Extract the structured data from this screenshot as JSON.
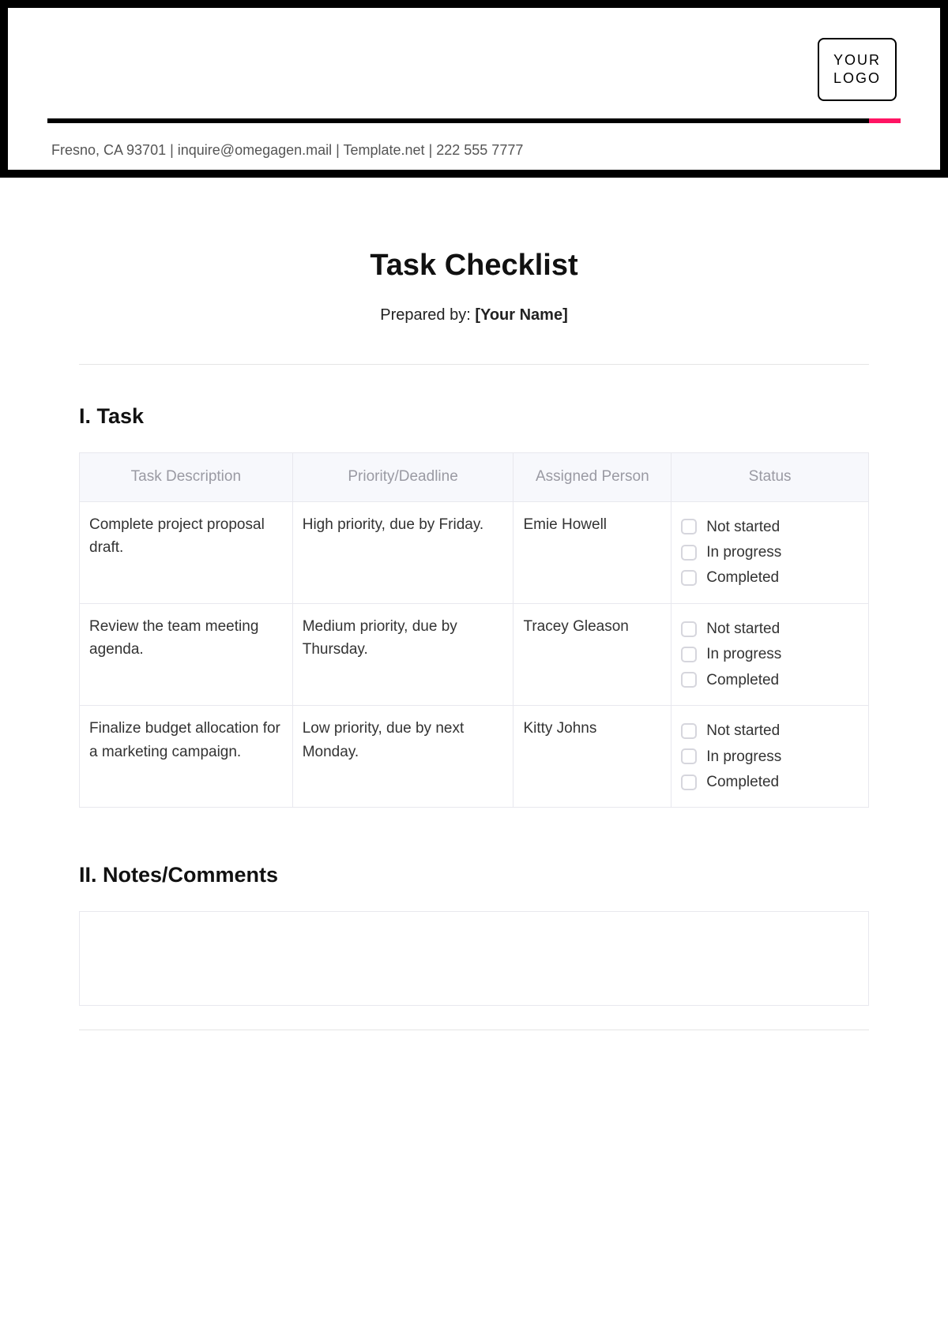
{
  "header": {
    "logo_line1": "YOUR",
    "logo_line2": "LOGO",
    "contact": "Fresno, CA 93701 | inquire@omegagen.mail | Template.net | 222 555 7777"
  },
  "title": "Task Checklist",
  "prepared_by_label": "Prepared by: ",
  "prepared_by_value": "[Your Name]",
  "section1_heading": "I. Task",
  "table": {
    "headers": {
      "desc": "Task Description",
      "priority": "Priority/Deadline",
      "assigned": "Assigned Person",
      "status": "Status"
    },
    "status_options": {
      "not_started": "Not started",
      "in_progress": "In progress",
      "completed": "Completed"
    },
    "rows": [
      {
        "desc": "Complete project proposal draft.",
        "priority": "High priority, due by Friday.",
        "assigned": "Emie Howell"
      },
      {
        "desc": "Review the team meeting agenda.",
        "priority": "Medium priority, due by Thursday.",
        "assigned": "Tracey Gleason"
      },
      {
        "desc": "Finalize budget allocation for a marketing campaign.",
        "priority": "Low priority, due by next Monday.",
        "assigned": "Kitty Johns"
      }
    ]
  },
  "section2_heading": "II. Notes/Comments"
}
